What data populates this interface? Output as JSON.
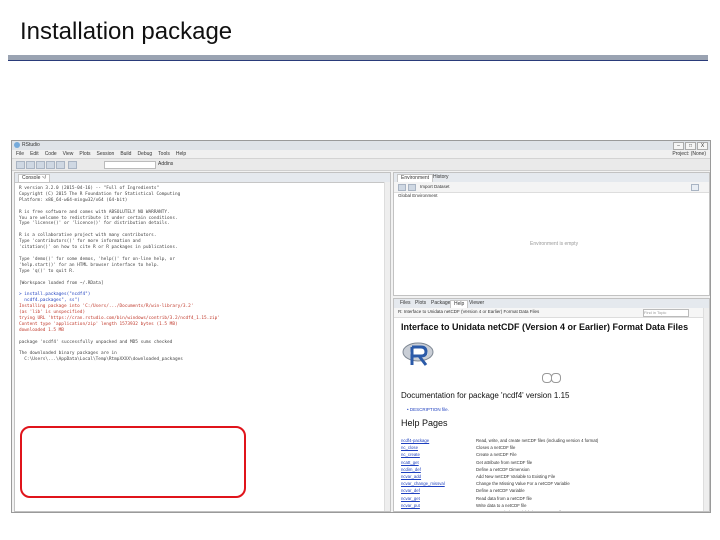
{
  "slide": {
    "title": "Installation package"
  },
  "window": {
    "title": "RStudio",
    "controls": [
      "–",
      "□",
      "X"
    ],
    "project": "Project: (None)"
  },
  "menu": [
    "File",
    "Edit",
    "Code",
    "View",
    "Plots",
    "Session",
    "Build",
    "Debug",
    "Tools",
    "Help"
  ],
  "toolbar": {
    "addins": "Addins"
  },
  "console": {
    "tab": "Console ~/",
    "lines": [
      {
        "t": "R version 3.2.0 (2015-04-16) -- \"Full of Ingredients\"",
        "c": ""
      },
      {
        "t": "Copyright (C) 2015 The R Foundation for Statistical Computing",
        "c": ""
      },
      {
        "t": "Platform: x86_64-w64-mingw32/x64 (64-bit)",
        "c": ""
      },
      {
        "t": "",
        "c": ""
      },
      {
        "t": "R is free software and comes with ABSOLUTELY NO WARRANTY.",
        "c": ""
      },
      {
        "t": "You are welcome to redistribute it under certain conditions.",
        "c": ""
      },
      {
        "t": "Type 'license()' or 'licence()' for distribution details.",
        "c": ""
      },
      {
        "t": "",
        "c": ""
      },
      {
        "t": "R is a collaborative project with many contributors.",
        "c": ""
      },
      {
        "t": "Type 'contributors()' for more information and",
        "c": ""
      },
      {
        "t": "'citation()' on how to cite R or R packages in publications.",
        "c": ""
      },
      {
        "t": "",
        "c": ""
      },
      {
        "t": "Type 'demo()' for some demos, 'help()' for on-line help, or",
        "c": ""
      },
      {
        "t": "'help.start()' for an HTML browser interface to help.",
        "c": ""
      },
      {
        "t": "Type 'q()' to quit R.",
        "c": ""
      },
      {
        "t": "",
        "c": ""
      },
      {
        "t": "[Workspace loaded from ~/.RData]",
        "c": ""
      },
      {
        "t": "",
        "c": ""
      },
      {
        "t": "> install.packages(\"ncdf4\")",
        "c": "blue"
      },
      {
        "t": "  ncdf4.packages\", ss\")",
        "c": "blue"
      },
      {
        "t": "Installing package into 'C:/Users/.../Documents/R/win-library/3.2'",
        "c": "red"
      },
      {
        "t": "(as 'lib' is unspecified)",
        "c": "red"
      },
      {
        "t": "trying URL 'https://cran.rstudio.com/bin/windows/contrib/3.2/ncdf4_1.15.zip'",
        "c": "red"
      },
      {
        "t": "Content type 'application/zip' length 1573932 bytes (1.5 MB)",
        "c": "red"
      },
      {
        "t": "downloaded 1.5 MB",
        "c": "red"
      },
      {
        "t": "",
        "c": ""
      },
      {
        "t": "package 'ncdf4' successfully unpacked and MD5 sums checked",
        "c": ""
      },
      {
        "t": "",
        "c": ""
      },
      {
        "t": "The downloaded binary packages are in",
        "c": ""
      },
      {
        "t": "  C:\\Users\\...\\AppData\\Local\\Temp\\RtmpXXXX\\downloaded_packages",
        "c": ""
      }
    ]
  },
  "environment": {
    "tabs": [
      "Environment",
      "History"
    ],
    "import_label": "Import Dataset",
    "global": "Global Environment",
    "empty": "Environment is empty"
  },
  "help": {
    "tabs": [
      "Files",
      "Plots",
      "Packages",
      "Help",
      "Viewer"
    ],
    "path": "R: Interface to Unidata netCDF (Version 4 or Earlier) Format Data Files",
    "search_placeholder": "Find in Topic",
    "heading": "Interface to Unidata netCDF (Version 4 or Earlier) Format Data Files",
    "doc_line": "Documentation for package 'ncdf4' version 1.15",
    "bullet": "DESCRIPTION file.",
    "pages_heading": "Help Pages",
    "functions": [
      {
        "fn": "ncdf4-package",
        "desc": "Read, write, and create netCDF files (including version 4 format)"
      },
      {
        "fn": "nc_close",
        "desc": "Closes a netCDF file"
      },
      {
        "fn": "nc_create",
        "desc": "Create a netCDF File"
      },
      {
        "fn": "ncatt_get",
        "desc": "Get attribute from netCDF file"
      },
      {
        "fn": "ncdim_def",
        "desc": "Define a netCDF Dimension"
      },
      {
        "fn": "ncvar_add",
        "desc": "Add New netCDF Variable to Existing File"
      },
      {
        "fn": "ncvar_change_missval",
        "desc": "Change the Missing Value For a netCDF Variable"
      },
      {
        "fn": "ncvar_def",
        "desc": "Define a netCDF Variable"
      },
      {
        "fn": "ncvar_get",
        "desc": "Read data from a netCDF file"
      },
      {
        "fn": "ncvar_put",
        "desc": "Write data to a netCDF file"
      },
      {
        "fn": "ncvar_rename",
        "desc": "Rename an Existing Variable in a netCDF File"
      }
    ]
  }
}
